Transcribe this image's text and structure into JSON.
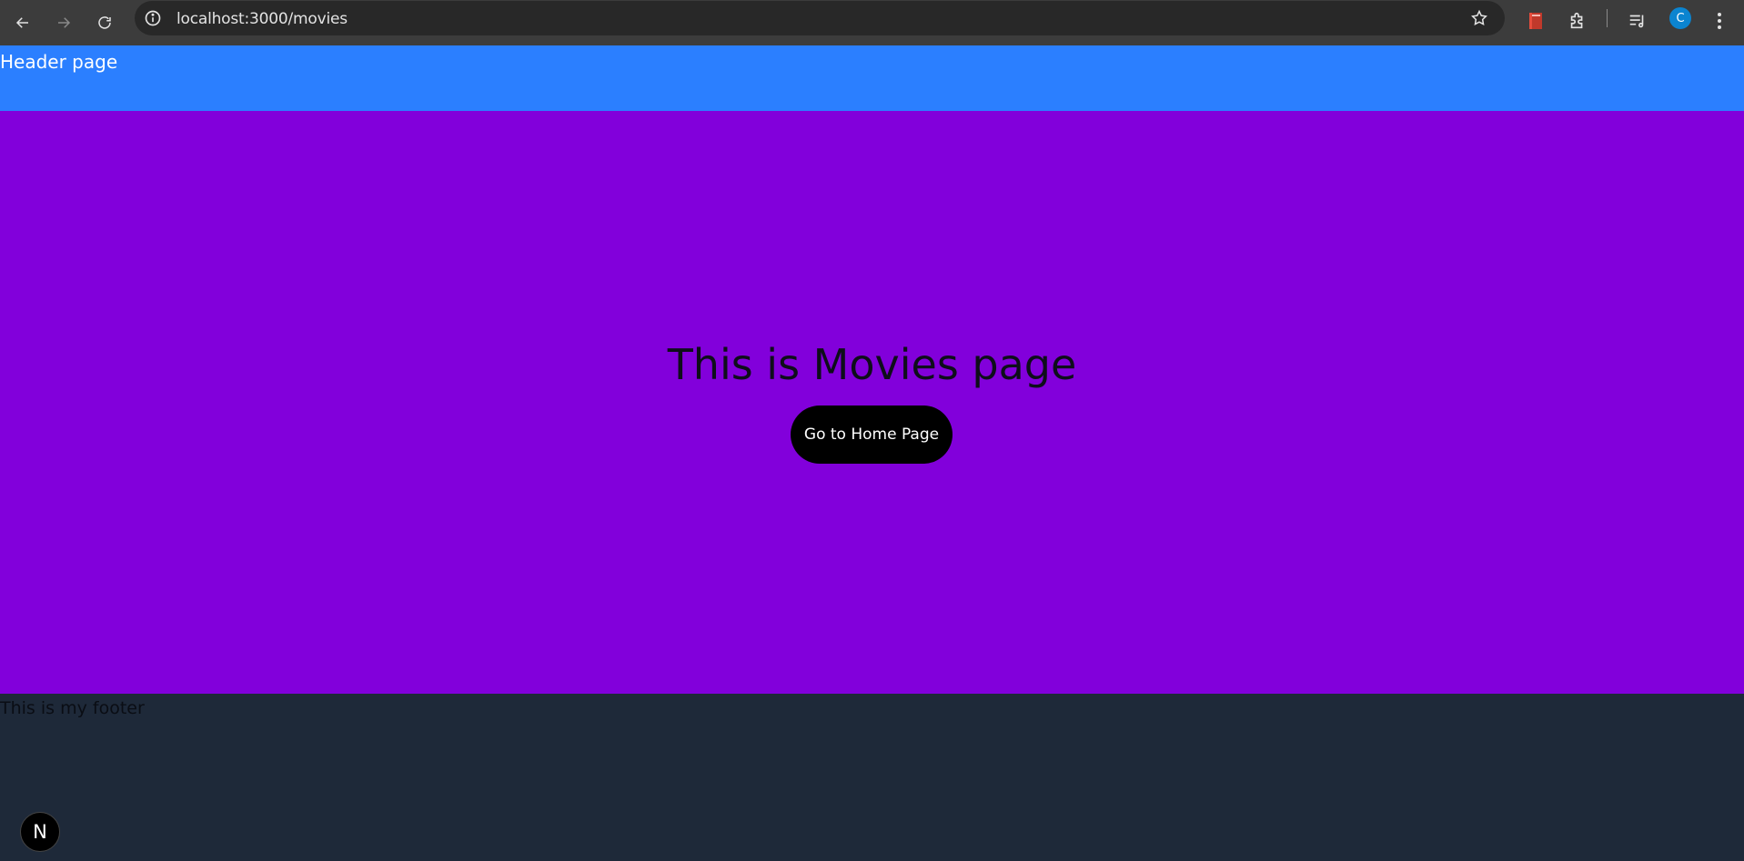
{
  "browser": {
    "url": "localhost:3000/movies",
    "profile_initial": "C",
    "icons": {
      "back": "arrow-left-icon",
      "forward": "arrow-right-icon",
      "reload": "reload-icon",
      "info": "info-icon",
      "bookmark": "star-icon",
      "reading_list": "bookmark-icon",
      "extensions": "puzzle-icon",
      "media": "media-playlist-icon",
      "menu": "kebab-menu-icon"
    }
  },
  "header": {
    "text": "Header page",
    "background": "#2b7fff"
  },
  "main": {
    "title": "This is Movies page",
    "button_label": "Go to Home Page",
    "background": "#8200db"
  },
  "footer": {
    "text": "This is my footer",
    "background": "#1e2939"
  },
  "dev_badge": {
    "label": "N"
  }
}
